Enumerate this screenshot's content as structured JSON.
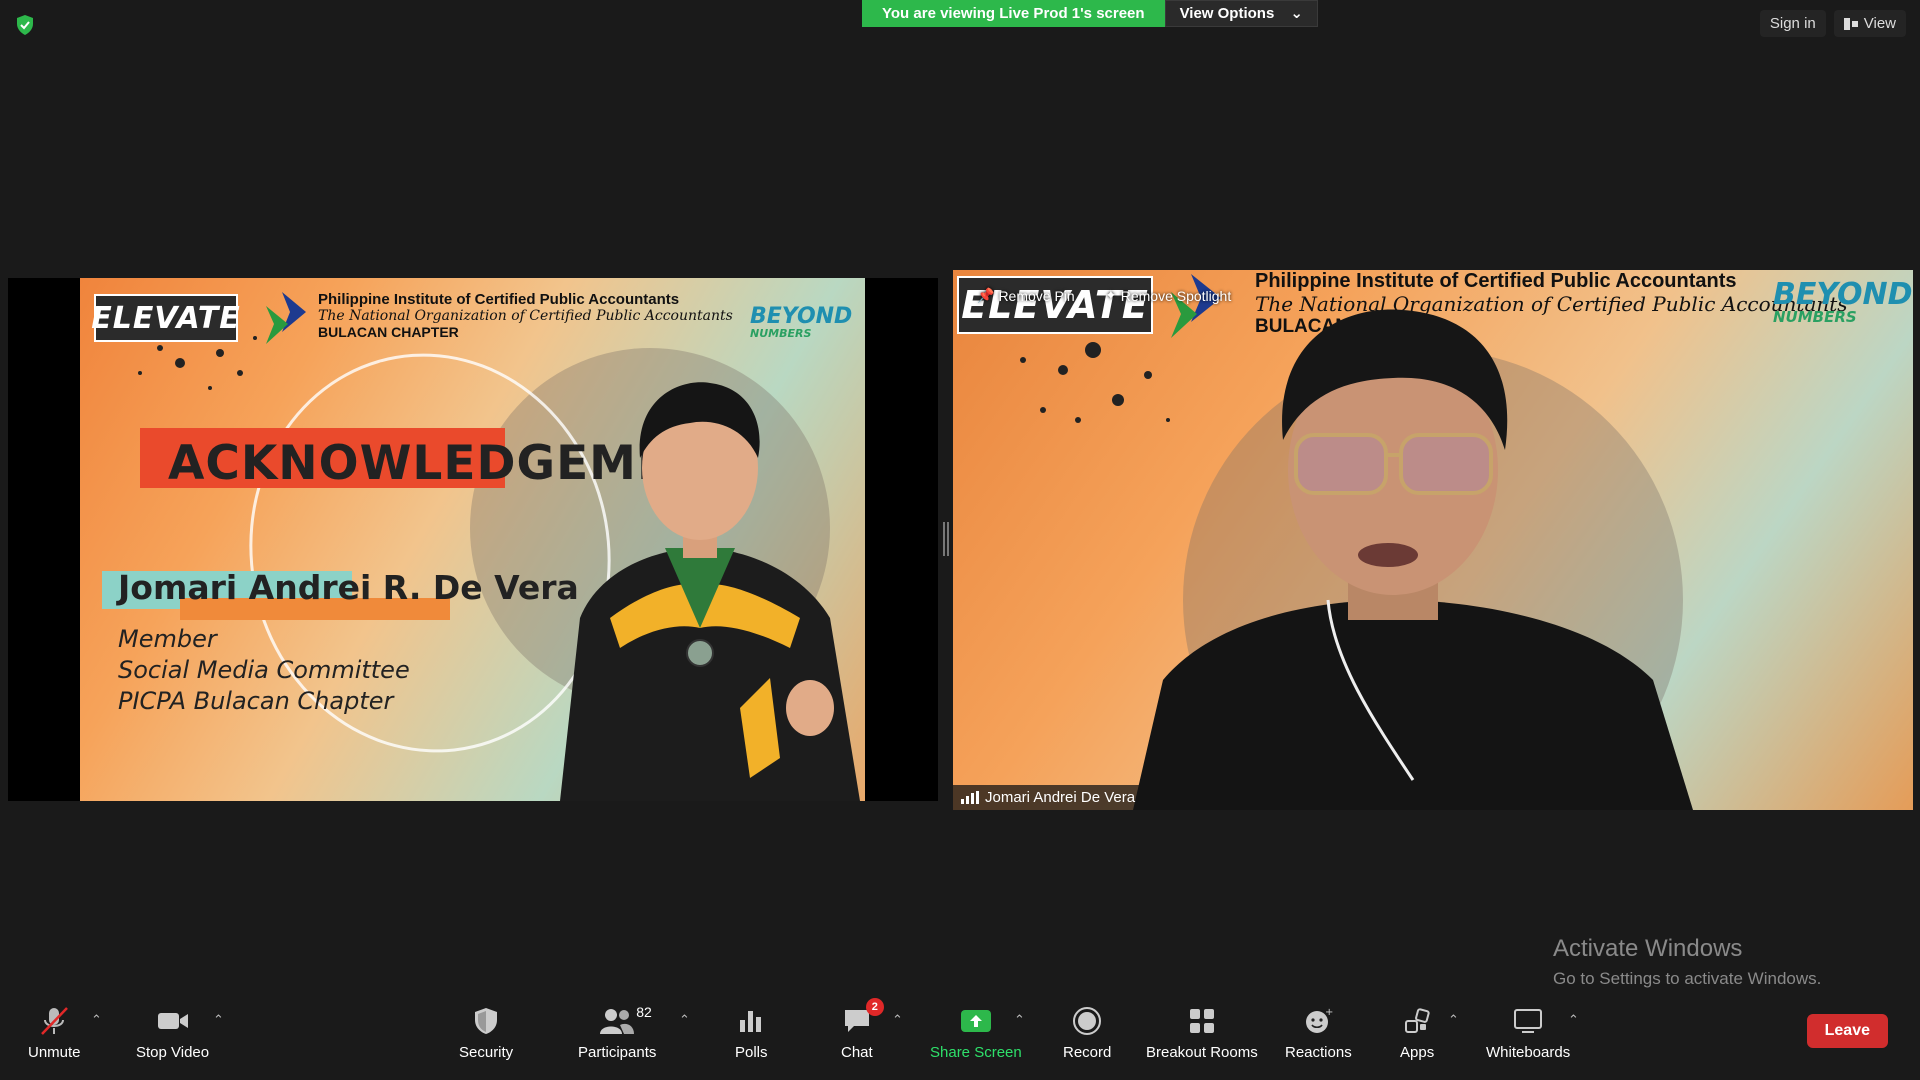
{
  "top": {
    "share_banner": "You are viewing Live Prod 1's screen",
    "view_options": "View Options",
    "sign_in": "Sign in",
    "view": "View"
  },
  "slide": {
    "elevate": "ELEVATE",
    "org_line1": "Philippine Institute of Certified Public Accountants",
    "org_line2": "The National Organization of Certified Public Accountants",
    "org_line3": "BULACAN CHAPTER",
    "beyond": "BEYOND",
    "numbers": "NUMBERS",
    "heading": "ACKNOWLEDGEMENT",
    "name": "Jomari Andrei R. De Vera",
    "role1": "Member",
    "role2": "Social Media Committee",
    "role3": "PICPA Bulacan Chapter"
  },
  "video": {
    "elevate": "ELEVATE",
    "org_line1": "Philippine Institute of Certified Public Accountants",
    "org_line2": "The National Organization of Certified Public Accountants",
    "org_line3": "BULACAN CHAPTER",
    "beyond": "BEYOND",
    "numbers": "NUMBERS",
    "remove_pin": "Remove Pin",
    "remove_spotlight": "Remove Spotlight",
    "participant_name": "Jomari Andrei De Vera"
  },
  "watermark": {
    "line1": "Activate Windows",
    "line2": "Go to Settings to activate Windows."
  },
  "toolbar": {
    "unmute": "Unmute",
    "stop_video": "Stop Video",
    "security": "Security",
    "participants": "Participants",
    "participants_count": "82",
    "polls": "Polls",
    "chat": "Chat",
    "chat_badge": "2",
    "share_screen": "Share Screen",
    "record": "Record",
    "breakout_rooms": "Breakout Rooms",
    "reactions": "Reactions",
    "apps": "Apps",
    "whiteboards": "Whiteboards",
    "leave": "Leave"
  },
  "colors": {
    "share_green": "#2db84b",
    "leave_red": "#d12d2d",
    "background": "#1a1a1a"
  }
}
